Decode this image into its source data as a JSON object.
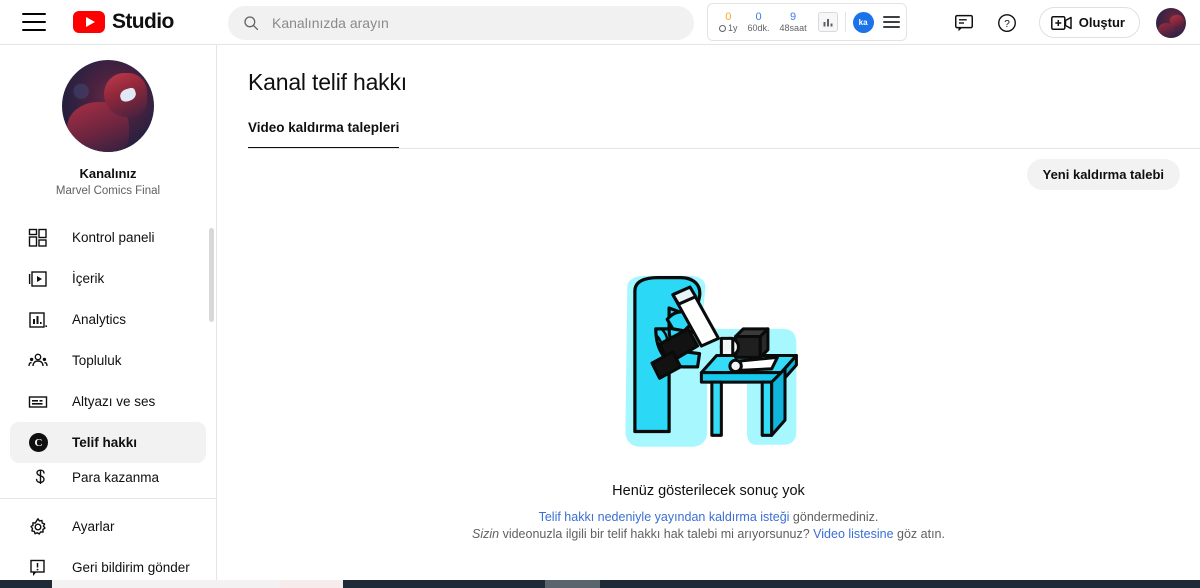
{
  "header": {
    "menu_icon": "hamburger-menu-icon",
    "brand": "Studio",
    "search_placeholder": "Kanalınızda arayın",
    "search_value": "",
    "stats": [
      {
        "num": "0",
        "label": "1y",
        "color": "#f5a623",
        "has_clock": true
      },
      {
        "num": "0",
        "label": "60dk.",
        "color": "#3b7ddd",
        "has_clock": false
      },
      {
        "num": "9",
        "label": "48saat",
        "color": "#3b7ddd",
        "has_clock": false
      }
    ],
    "chart_button_icon": "bar-chart-icon",
    "blue_badge_text": "ka",
    "mini_menu_icon": "list-menu-icon",
    "feedback_icon": "comment-icon",
    "help_icon": "help-circle-icon",
    "create_label": "Oluştur",
    "create_icon": "video-plus-icon",
    "avatar_icon": "user-avatar"
  },
  "sidebar": {
    "channel_label": "Kanalınız",
    "channel_name": "Marvel Comics Final",
    "items": [
      {
        "label": "Kontrol paneli",
        "icon": "dashboard-icon",
        "active": false
      },
      {
        "label": "İçerik",
        "icon": "content-video-icon",
        "active": false
      },
      {
        "label": "Analytics",
        "icon": "analytics-bar-icon",
        "active": false
      },
      {
        "label": "Topluluk",
        "icon": "community-people-icon",
        "active": false
      },
      {
        "label": "Altyazı ve ses",
        "icon": "subtitles-icon",
        "active": false
      },
      {
        "label": "Telif hakkı",
        "icon": "copyright-icon",
        "active": true
      },
      {
        "label": "Para kazanma",
        "icon": "monetization-icon",
        "active": false
      }
    ],
    "footer_items": [
      {
        "label": "Ayarlar",
        "icon": "gear-icon"
      },
      {
        "label": "Geri bildirim gönder",
        "icon": "feedback-flag-icon"
      }
    ]
  },
  "main": {
    "page_title": "Kanal telif hakkı",
    "tabs": [
      {
        "label": "Video kaldırma talepleri",
        "active": true
      }
    ],
    "new_request_button": "Yeni kaldırma talebi",
    "empty_state": {
      "illustration": "person-filming-camera-illustration",
      "title": "Henüz gösterilecek sonuç yok",
      "line1_link": "Telif hakkı nedeniyle yayından kaldırma isteği",
      "line1_rest": " göndermediniz.",
      "line2_italic": "Sizin",
      "line2_mid": " videonuzla ilgili bir telif hakkı hak talebi mi arıyorsunuz? ",
      "line2_link": "Video listesine",
      "line2_end": " göz atın."
    }
  },
  "colors": {
    "brand_red": "#ff0000",
    "link_blue": "#3b6fd4",
    "illustration_cyan": "#1fd4f5",
    "accent_orange": "#f5a623"
  }
}
